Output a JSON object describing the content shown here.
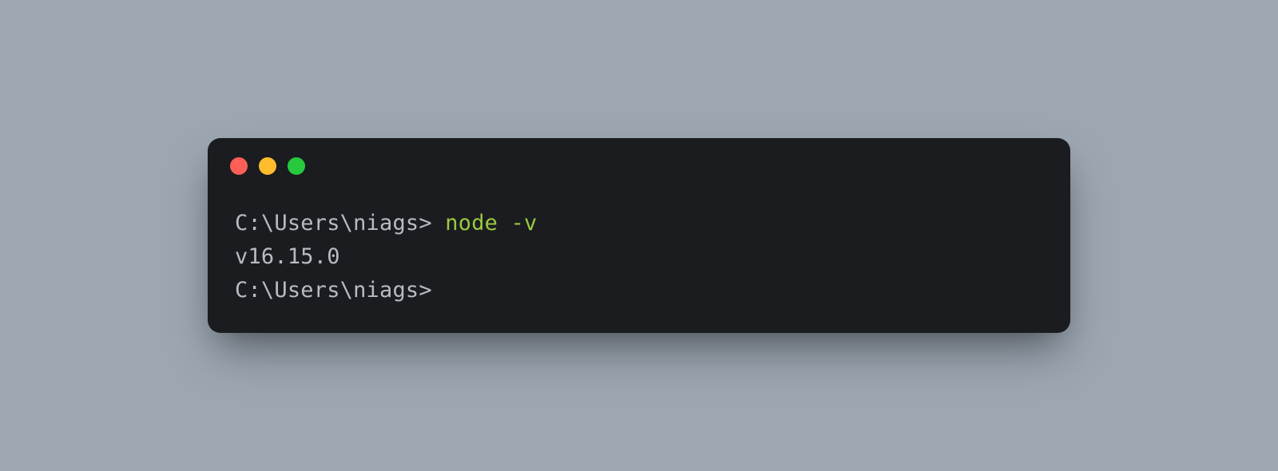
{
  "terminal": {
    "window_controls": {
      "close_color": "#ff5f56",
      "minimize_color": "#ffbd2e",
      "maximize_color": "#27c93f"
    },
    "lines": [
      {
        "prompt": "C:\\Users\\niags> ",
        "command": "node -v"
      },
      {
        "output": "v16.15.0"
      },
      {
        "prompt": "C:\\Users\\niags>",
        "command": ""
      }
    ]
  }
}
